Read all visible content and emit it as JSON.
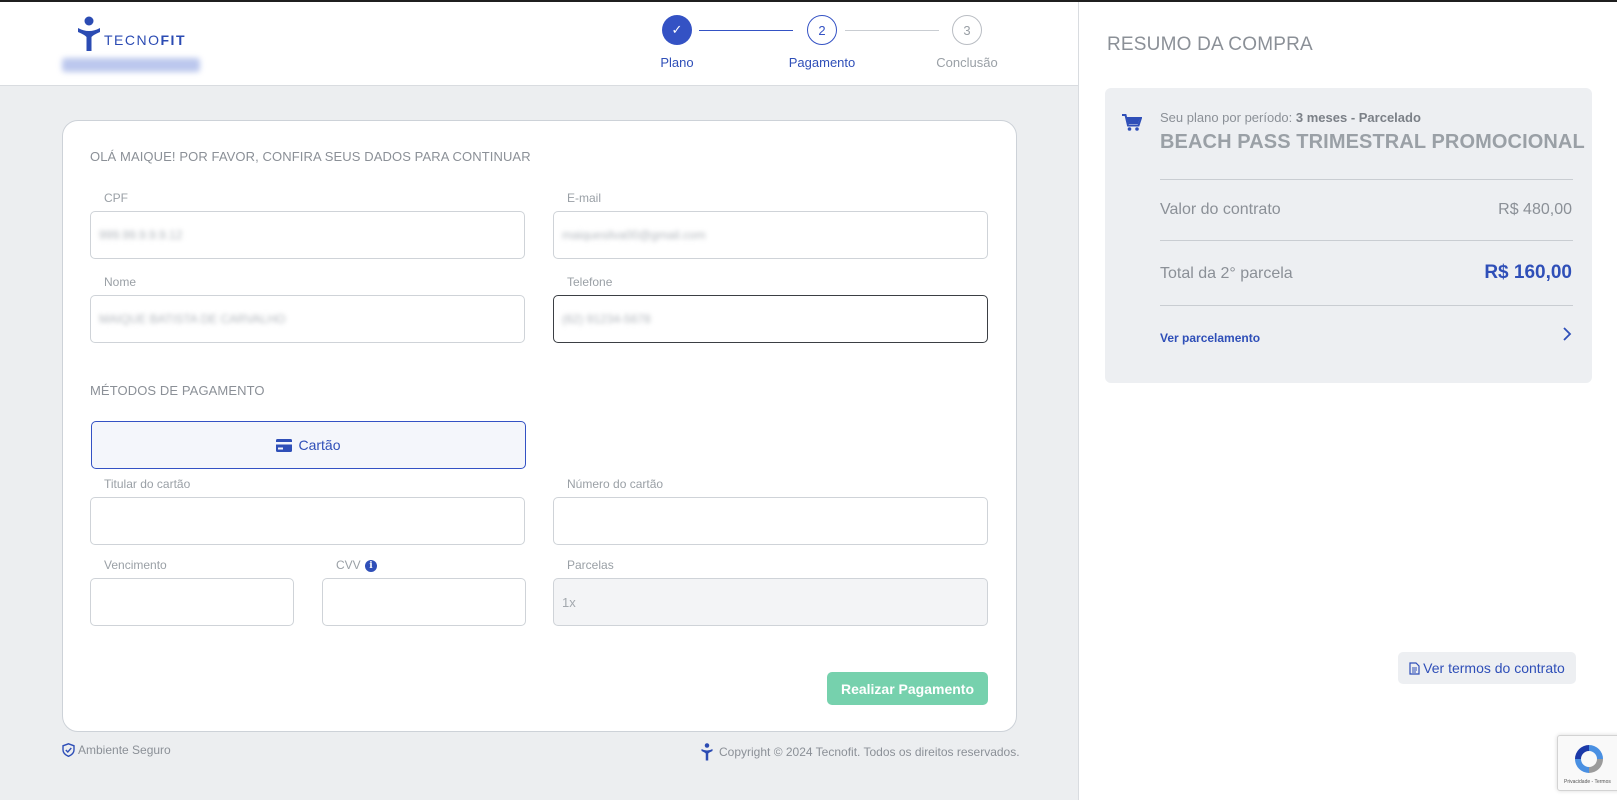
{
  "brand": {
    "name_regular": "TECNO",
    "name_bold": "FIT",
    "colors": {
      "primary": "#2f4fb8",
      "success": "#76d1ad",
      "muted": "#8b9097"
    }
  },
  "stepper": {
    "steps": [
      {
        "number": "✓",
        "label": "Plano",
        "state": "done"
      },
      {
        "number": "2",
        "label": "Pagamento",
        "state": "active"
      },
      {
        "number": "3",
        "label": "Conclusão",
        "state": "pending"
      }
    ]
  },
  "form": {
    "greeting": "OLÁ MAIQUE! POR FAVOR, CONFIRA SEUS DADOS PARA CONTINUAR",
    "cpf": {
      "label": "CPF"
    },
    "email": {
      "label": "E-mail"
    },
    "nome": {
      "label": "Nome"
    },
    "telefone": {
      "label": "Telefone"
    },
    "payment_methods_title": "MÉTODOS DE PAGAMENTO",
    "payment_method_card": "Cartão",
    "titular": {
      "label": "Titular do cartão",
      "value": ""
    },
    "numero": {
      "label": "Número do cartão",
      "value": ""
    },
    "vencimento": {
      "label": "Vencimento",
      "value": ""
    },
    "cvv": {
      "label": "CVV",
      "value": ""
    },
    "parcelas": {
      "label": "Parcelas",
      "value": "1x"
    },
    "submit_label": "Realizar Pagamento"
  },
  "footer": {
    "secure": "Ambiente Seguro",
    "copyright": "Copyright © 2024 Tecnofit. Todos os direitos reservados."
  },
  "summary": {
    "title": "RESUMO DA COMPRA",
    "plan_prefix": "Seu plano por período: ",
    "plan_period": "3 meses - Parcelado",
    "plan_name": "BEACH PASS TRIMESTRAL PROMOCIONAL",
    "contract_label": "Valor do contrato",
    "contract_value": "R$ 480,00",
    "installment_label": "Total da 2° parcela",
    "installment_value": "R$ 160,00",
    "installments_link": "Ver parcelamento",
    "terms_button": "Ver termos do contrato"
  },
  "recaptcha": {
    "text": "Privacidade - Termos"
  }
}
